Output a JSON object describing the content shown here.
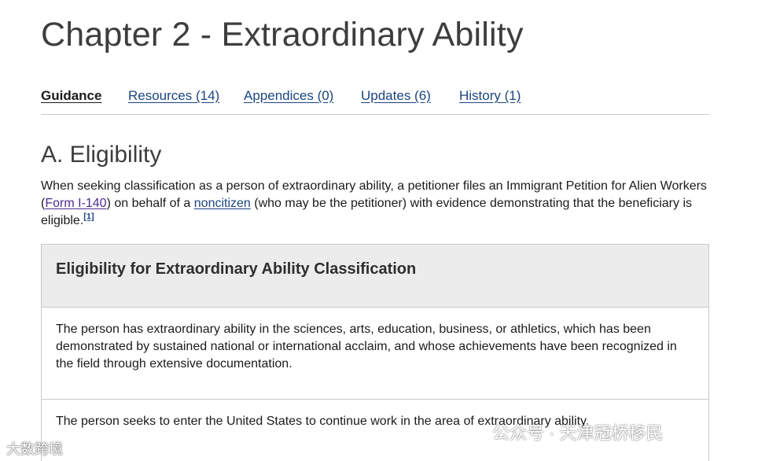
{
  "page": {
    "title": "Chapter 2 - Extraordinary Ability"
  },
  "tabs": [
    {
      "label": "Guidance",
      "active": true
    },
    {
      "label": "Resources (14)",
      "active": false
    },
    {
      "label": "Appendices (0)",
      "active": false
    },
    {
      "label": "Updates (6)",
      "active": false
    },
    {
      "label": "History (1)",
      "active": false
    }
  ],
  "section": {
    "heading": "A. Eligibility",
    "intro_part1": "When seeking classification as a person of extraordinary ability, a petitioner files an Immigrant Petition for Alien Workers (",
    "form_link": "Form I-140",
    "intro_part2": ") on behalf of a ",
    "noncitizen_link": "noncitizen",
    "intro_part3": " (who may be the petitioner) with evidence demonstrating that the beneficiary is eligible.",
    "footnote": "[1]"
  },
  "eligibility_table": {
    "header": "Eligibility for Extraordinary Ability Classification",
    "rows": [
      "The person has extraordinary ability in the sciences, arts, education, business, or athletics, which has been demonstrated by sustained national or international acclaim, and whose achievements have been recognized in the field through extensive documentation.",
      "The person seeks to enter the United States to continue work in the area of extraordinary ability."
    ]
  },
  "watermarks": {
    "left": "大数跨境",
    "right": "公众号 · 天津冠桥移民"
  },
  "colors": {
    "link": "#1a4480",
    "visited_link": "#4c2c92",
    "table_header_bg": "#ececec",
    "border": "#c9c9c9"
  }
}
